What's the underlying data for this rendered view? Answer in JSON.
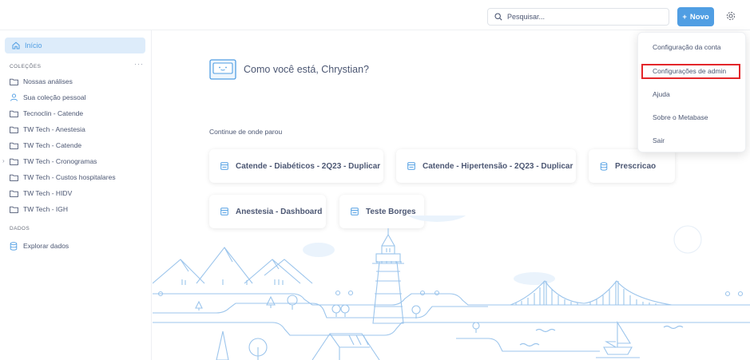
{
  "header": {
    "search_placeholder": "Pesquisar...",
    "new_button_label": "Novo",
    "new_button_plus": "+"
  },
  "sidebar": {
    "home_label": "Início",
    "collections_title": "COLEÇÕES",
    "collections_menu": "···",
    "collections": [
      {
        "label": "Nossas análises",
        "icon": "folder-icon"
      },
      {
        "label": "Sua coleção pessoal",
        "icon": "person-icon"
      },
      {
        "label": "Tecnoclin - Catende",
        "icon": "folder-icon"
      },
      {
        "label": "TW Tech - Anestesia",
        "icon": "folder-icon"
      },
      {
        "label": "TW Tech - Catende",
        "icon": "folder-icon"
      },
      {
        "label": "TW Tech - Cronogramas",
        "icon": "folder-icon",
        "expandable": true
      },
      {
        "label": "TW Tech - Custos hospitalares",
        "icon": "folder-icon"
      },
      {
        "label": "TW Tech - HIDV",
        "icon": "folder-icon"
      },
      {
        "label": "TW Tech - IGH",
        "icon": "folder-icon"
      }
    ],
    "expand_chevron": "›",
    "data_title": "DADOS",
    "data_items": [
      {
        "label": "Explorar dados",
        "icon": "database-icon"
      }
    ]
  },
  "main": {
    "greeting": "Como você está, Chrystian?",
    "continue_title": "Continue de onde parou",
    "recent_items": [
      {
        "label": "Catende - Diabéticos - 2Q23 - Duplicar",
        "icon": "dashboard-icon"
      },
      {
        "label": "Catende - Hipertensão - 2Q23 - Duplicar",
        "icon": "dashboard-icon"
      },
      {
        "label": "Prescricao",
        "icon": "database-icon"
      },
      {
        "label": "Anestesia - Dashboard",
        "icon": "dashboard-icon"
      },
      {
        "label": "Teste Borges",
        "icon": "dashboard-icon"
      }
    ]
  },
  "settings_menu": {
    "items": [
      {
        "label": "Configuração da conta"
      },
      {
        "label": "Configurações de admin",
        "highlighted": true
      },
      {
        "label": "Ajuda"
      },
      {
        "label": "Sobre o Metabase"
      },
      {
        "label": "Sair"
      }
    ]
  },
  "colors": {
    "brand": "#509ee3",
    "text": "#4c5773",
    "highlight_box": "#e3262a",
    "illustration_line": "#9cc5ec"
  }
}
